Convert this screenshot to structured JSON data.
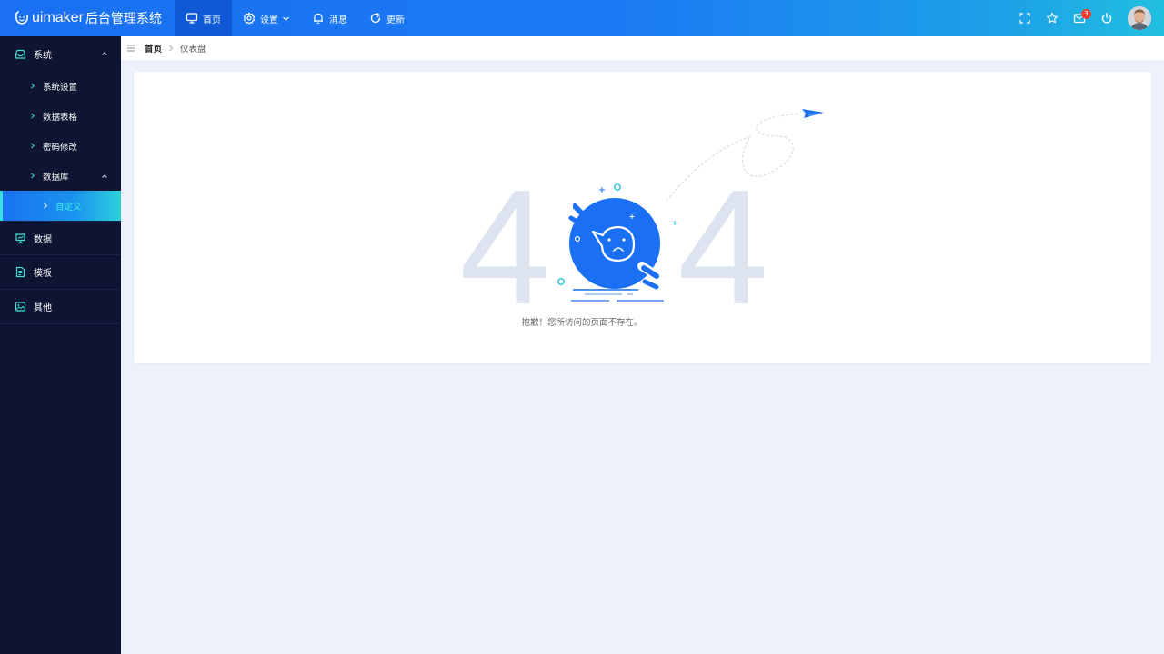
{
  "app": {
    "brand": "uimaker",
    "title": "后台管理系统"
  },
  "topnav": [
    {
      "label": "首页",
      "icon": "monitor-icon",
      "active": true
    },
    {
      "label": "设置",
      "icon": "gear-icon"
    },
    {
      "label": "消息",
      "icon": "bell-icon"
    },
    {
      "label": "更新",
      "icon": "refresh-icon"
    }
  ],
  "topright": {
    "mail_badge": "3"
  },
  "sidebar": {
    "group1": {
      "label": "系统",
      "icon": "inbox-icon"
    },
    "sub": [
      {
        "label": "系统设置"
      },
      {
        "label": "数据表格"
      },
      {
        "label": "密码修改"
      },
      {
        "label": "数据库"
      },
      {
        "label": "自定义",
        "active": true
      }
    ],
    "groups": [
      {
        "label": "数据",
        "icon": "presentation-icon"
      },
      {
        "label": "模板",
        "icon": "document-icon"
      },
      {
        "label": "其他",
        "icon": "image-icon"
      }
    ]
  },
  "breadcrumb": {
    "home": "首页",
    "current": "仪表盘"
  },
  "error": {
    "left_digit": "4",
    "right_digit": "4",
    "message": "抱歉！您所访问的页面不存在。"
  },
  "colors": {
    "accent": "#1a6ff2",
    "sidebar_bg": "#0e1533",
    "active_cyan": "#2bd0db",
    "digit": "#dde4ef"
  }
}
